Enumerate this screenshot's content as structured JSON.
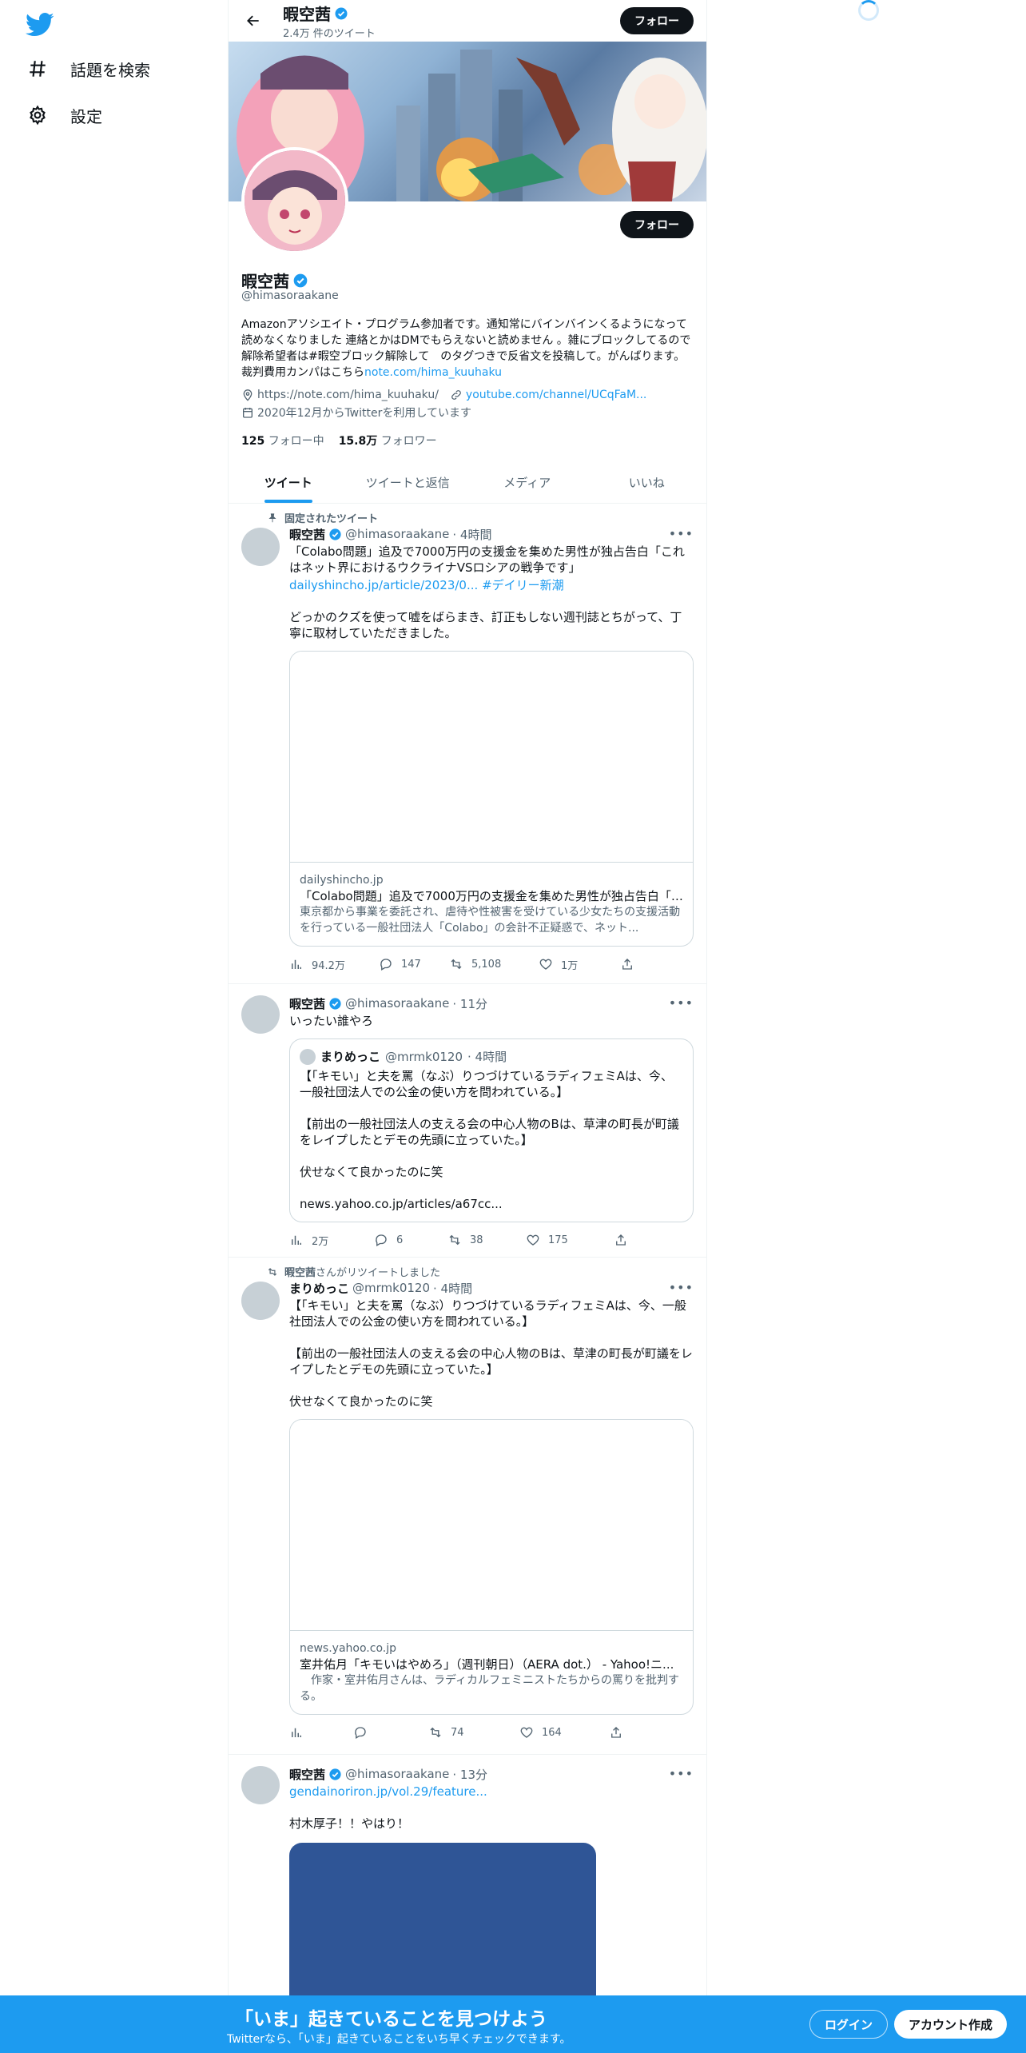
{
  "nav": {
    "items": [
      {
        "label": "話題を検索",
        "icon": "hashtag-icon"
      },
      {
        "label": "設定",
        "icon": "gear-icon"
      }
    ]
  },
  "header": {
    "name": "暇空茜",
    "tweet_count": "2.4万 件のツイート",
    "follow_label": "フォロー"
  },
  "profile": {
    "name": "暇空茜",
    "handle": "@himasoraakane",
    "follow_label": "フォロー",
    "bio": "Amazonアソシエイト・プログラム参加者です。通知常にバインバインくるようになって読めなくなりました 連絡とかはDMでもらえないと読めません 。雑にブロックしてるので解除希望者は#暇空ブロック解除して　のタグつきで反省文を投稿して。がんばります。裁判費用カンパはこちら",
    "bio_link": "note.com/hima_kuuhaku",
    "location": "https://note.com/hima_kuuhaku/",
    "url": "youtube.com/channel/UCqFaM...",
    "joined": "2020年12月からTwitterを利用しています",
    "following_count": "125",
    "following_label": "フォロー中",
    "followers_count": "15.8万",
    "followers_label": "フォロワー"
  },
  "tabs": [
    {
      "label": "ツイート",
      "active": true
    },
    {
      "label": "ツイートと返信",
      "active": false
    },
    {
      "label": "メディア",
      "active": false
    },
    {
      "label": "いいね",
      "active": false
    }
  ],
  "tweets": [
    {
      "context": "固定されたツイート",
      "name": "暇空茜",
      "handle": "@himasoraakane",
      "time": "· 4時間",
      "text": "「Colabo問題」追及で7000万円の支援金を集めた男性が独占告白「これはネット界におけるウクライナVSロシアの戦争です」",
      "link": "dailyshincho.jp/article/2023/0...",
      "hashtag": "#デイリー新潮",
      "text2": "どっかのクズを使って嘘をばらまき、訂正もしない週刊誌とちがって、丁寧に取材していただきました。",
      "card": {
        "domain": "dailyshincho.jp",
        "title": "「Colabo問題」追及で7000万円の支援金を集めた男性が独占告白「こ...",
        "desc": "東京都から事業を委託され、虐待や性被害を受けている少女たちの支援活動を行っている一般社団法人「Colabo」の会計不正疑惑で、ネット..."
      },
      "views": "94.2万",
      "replies": "147",
      "retweets": "5,108",
      "likes": "1万"
    },
    {
      "name": "暇空茜",
      "handle": "@himasoraakane",
      "time": "· 11分",
      "text": "いったい誰やろ",
      "quote": {
        "name": "まりめっこ",
        "handle": "@mrmk0120",
        "time": "· 4時間",
        "text": "【「キモい」と夫を罵（なぶ）りつづけているラディフェミAは、今、一般社団法人での公金の使い方を問われている。】\n\n【前出の一般社団法人の支える会の中心人物のBは、草津の町長が町議をレイプしたとデモの先頭に立っていた。】\n\n伏せなくて良かったのに笑\n\nnews.yahoo.co.jp/articles/a67cc..."
      },
      "views": "2万",
      "replies": "6",
      "retweets": "38",
      "likes": "175"
    },
    {
      "context": "暇空茜",
      "context_suffix": "さんがリツイートしました",
      "name": "まりめっこ",
      "handle": "@mrmk0120",
      "time": "· 4時間",
      "text": "【「キモい」と夫を罵（なぶ）りつづけているラディフェミAは、今、一般社団法人での公金の使い方を問われている。】\n\n【前出の一般社団法人の支える会の中心人物のBは、草津の町長が町議をレイプしたとデモの先頭に立っていた。】\n\n伏せなくて良かったのに笑",
      "card": {
        "domain": "news.yahoo.co.jp",
        "title": "室井佑月「キモいはやめろ」（週刊朝日）（AERA dot.） - Yahoo!ニ...",
        "desc": "　作家・室井佑月さんは、ラディカルフェミニストたちからの罵りを批判する。"
      },
      "retweets": "74",
      "likes": "164"
    },
    {
      "name": "暇空茜",
      "handle": "@himasoraakane",
      "time": "· 13分",
      "link": "gendainoriron.jp/vol.29/feature...",
      "text": "村木厚子！！やはり！"
    }
  ],
  "bottom_bar": {
    "title": "「いま」起きていることを見つけよう",
    "subtitle": "Twitterなら、「いま」起きていることをいち早くチェックできます。",
    "login": "ログイン",
    "signup": "アカウント作成"
  },
  "colors": {
    "accent": "#1d9bf0",
    "text": "#0f1419",
    "secondary": "#536471"
  }
}
